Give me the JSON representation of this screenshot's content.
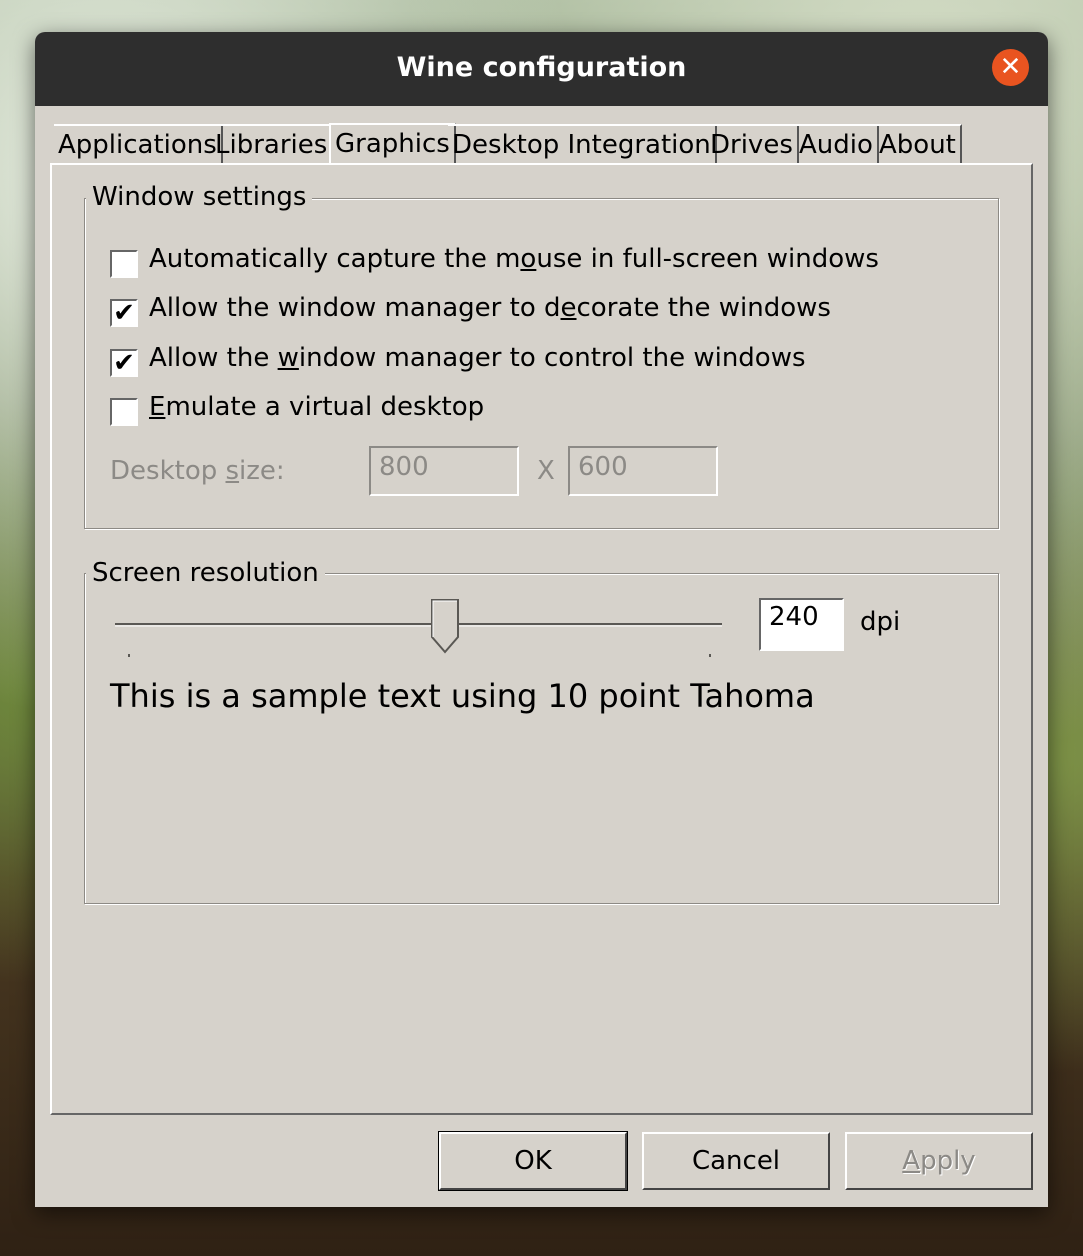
{
  "window": {
    "title": "Wine configuration"
  },
  "tabs": [
    {
      "label": "Applications"
    },
    {
      "label": "Libraries"
    },
    {
      "label": "Graphics"
    },
    {
      "label": "Desktop Integration"
    },
    {
      "label": "Drives"
    },
    {
      "label": "Audio"
    },
    {
      "label": "About"
    }
  ],
  "active_tab": "Graphics",
  "window_settings": {
    "title": "Window settings",
    "options": [
      {
        "pre": "Automatically capture the m",
        "ul": "o",
        "post": "use in full-screen windows",
        "checked": false
      },
      {
        "pre": "Allow the window manager to d",
        "ul": "e",
        "post": "corate the windows",
        "checked": true
      },
      {
        "pre": "Allow the ",
        "ul": "w",
        "post": "indow manager to control the windows",
        "checked": true
      },
      {
        "pre": "",
        "ul": "E",
        "post": "mulate a virtual desktop",
        "checked": false
      }
    ],
    "desktop_size": {
      "label_pre": "Desktop ",
      "label_ul": "s",
      "label_post": "ize:",
      "width": "800",
      "separator": "X",
      "height": "600"
    }
  },
  "screen_resolution": {
    "title": "Screen resolution",
    "dpi_value": "240",
    "dpi_unit": "dpi",
    "slider_level_percent": 55,
    "sample_text": "This is a sample text using 10 point Tahoma"
  },
  "buttons": {
    "ok": "OK",
    "cancel": "Cancel",
    "apply_ul": "A",
    "apply_rest": "pply"
  },
  "colors": {
    "close_button": "#e95420",
    "titlebar": "#2e2e2e",
    "dialog_bg": "#d6d2cb"
  },
  "icons": {
    "close": "close-icon",
    "checkmark": "checkmark-icon"
  }
}
